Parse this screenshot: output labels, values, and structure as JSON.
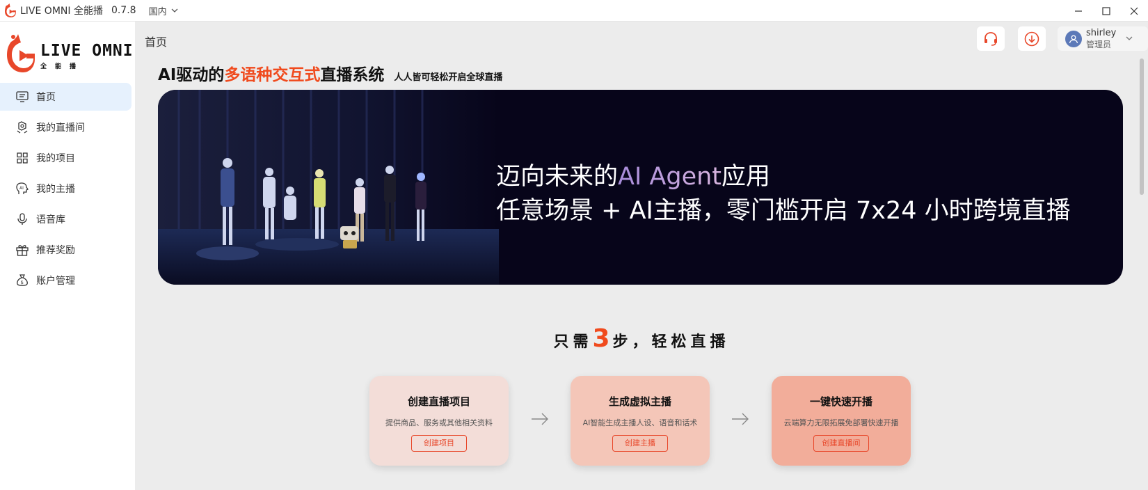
{
  "titlebar": {
    "app_name": "LIVE OMNI 全能播",
    "version": "0.7.8",
    "region": "国内"
  },
  "sidebar": {
    "brand_name": "LIVE OMNI",
    "brand_sub": "全能播",
    "items": [
      {
        "label": "首页",
        "icon": "home-icon",
        "active": true
      },
      {
        "label": "我的直播间",
        "icon": "live-room-icon"
      },
      {
        "label": "我的项目",
        "icon": "grid-icon"
      },
      {
        "label": "我的主播",
        "icon": "ai-head-icon"
      },
      {
        "label": "语音库",
        "icon": "microphone-icon"
      },
      {
        "label": "推荐奖励",
        "icon": "gift-icon"
      },
      {
        "label": "账户管理",
        "icon": "money-bag-icon"
      }
    ]
  },
  "header": {
    "page_title": "首页",
    "user": {
      "name": "shirley",
      "role": "管理员"
    }
  },
  "headline": {
    "part1": "AI驱动的",
    "accent": "多语种交互式",
    "part2": "直播系统",
    "sub": "人人皆可轻松开启全球直播"
  },
  "banner": {
    "line1_a": "迈向未来的",
    "line1_accent": "AI Agent",
    "line1_b": "应用",
    "line2": "任意场景 + AI主播，零门槛开启 7x24 小时跨境直播"
  },
  "steps": {
    "title_a": "只需",
    "title_num": "3",
    "title_b": "步，轻松直播",
    "items": [
      {
        "title": "创建直播项目",
        "desc": "提供商品、服务或其他相关资料",
        "button": "创建项目",
        "color": "#f3ddd8"
      },
      {
        "title": "生成虚拟主播",
        "desc": "AI智能生成主播人设、语音和话术",
        "button": "创建主播",
        "color": "#f4c6b8"
      },
      {
        "title": "一键快速开播",
        "desc": "云端算力无限拓展免部署快速开播",
        "button": "创建直播间",
        "color": "#f2ad9a"
      }
    ]
  },
  "colors": {
    "accent": "#f04a1d",
    "nav_active": "#e6f1fd",
    "banner_bg": "#07051a"
  }
}
